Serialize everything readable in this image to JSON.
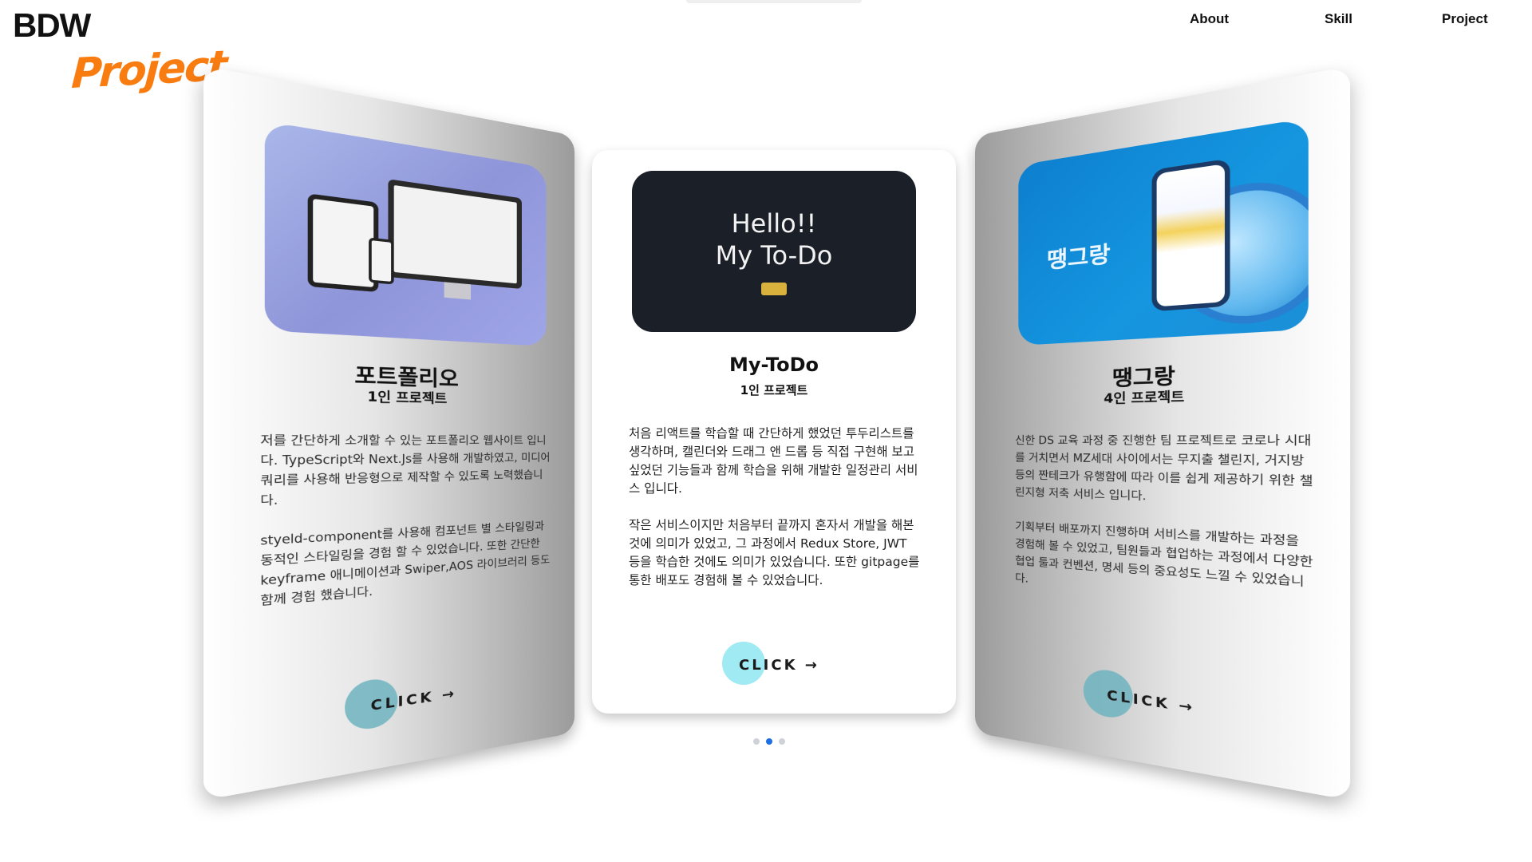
{
  "header": {
    "logo": "BDW",
    "section_title": "Project"
  },
  "nav": {
    "items": [
      "About",
      "Skill",
      "Project"
    ]
  },
  "carousel": {
    "active_index": 1,
    "pagination_count": 3,
    "cards": [
      {
        "title": "포트폴리오",
        "subtitle": "1인 프로젝트",
        "desc": [
          "저를 간단하게 소개할 수 있는 포트폴리오 웹사이트 입니다. TypeScript와 Next.Js를 사용해 개발하였고, 미디어 쿼리를 사용해 반응형으로 제작할 수 있도록 노력했습니다.",
          "styeld-component를 사용해 컴포넌트 별 스타일링과 동적인 스타일링을 경험 할 수 있었습니다. 또한 간단한 keyframe 애니메이션과 Swiper,AOS 라이브러리 등도 함께 경험 했습니다."
        ],
        "button": "CLICK →"
      },
      {
        "title": "My-ToDo",
        "subtitle": "1인 프로젝트",
        "thumb_text": [
          "Hello!!",
          "My To-Do"
        ],
        "desc": [
          "처음 리액트를 학습할 때 간단하게 했었던 투두리스트를 생각하며, 캘린더와 드래그 앤 드롭 등 직접 구현해 보고 싶었던 기능들과 함께 학습을 위해 개발한 일정관리 서비스 입니다.",
          "작은 서비스이지만 처음부터 끝까지 혼자서 개발을 해본 것에 의미가 있었고, 그 과정에서 Redux Store, JWT 등을 학습한 것에도 의미가 있었습니다. 또한 gitpage를 통한 배포도 경험해 볼 수 있었습니다."
        ],
        "button": "CLICK →"
      },
      {
        "title": "땡그랑",
        "subtitle": "4인 프로젝트",
        "thumb_brand": "땡그랑",
        "desc": [
          "신한 DS 교육 과정 중 진행한 팀 프로젝트로 코로나 시대를 거치면서 MZ세대 사이에서는 무지출 챌린지, 거지방 등의 짠테크가 유행함에 따라 이를 쉽게 제공하기 위한 챌린지형 저축 서비스 입니다.",
          "기획부터 배포까지 진행하며 서비스를 개발하는 과정을 경험해 볼 수 있었고, 팀원들과 협업하는 과정에서 다양한 협업 툴과 컨벤션, 명세 등의 중요성도 느낄 수 있었습니다."
        ],
        "button": "CLICK →"
      }
    ]
  },
  "colors": {
    "accent_orange": "#f97c10",
    "todo_bg": "#1b1f28",
    "active_dot": "#1f6fe0",
    "click_blob": "#9feaf3"
  }
}
